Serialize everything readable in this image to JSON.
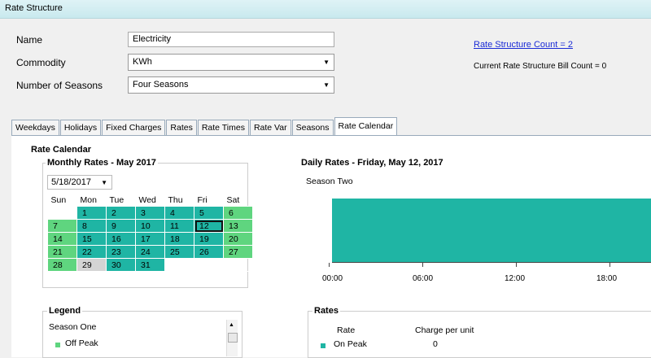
{
  "window": {
    "title": "Rate Structure"
  },
  "form": {
    "name_label": "Name",
    "name_value": "Electricity",
    "commodity_label": "Commodity",
    "commodity_value": "KWh",
    "seasons_label": "Number of Seasons",
    "seasons_value": "Four Seasons",
    "count_link": "Rate Structure Count = 2",
    "bill_count": "Current Rate Structure Bill Count = 0"
  },
  "tabs": [
    {
      "label": "Weekdays",
      "active": false
    },
    {
      "label": "Holidays",
      "active": false
    },
    {
      "label": "Fixed Charges",
      "active": false
    },
    {
      "label": "Rates",
      "active": false
    },
    {
      "label": "Rate Times",
      "active": false
    },
    {
      "label": "Rate Var",
      "active": false
    },
    {
      "label": "Seasons",
      "active": false
    },
    {
      "label": "Rate Calendar",
      "active": true
    }
  ],
  "rate_calendar": {
    "title": "Rate Calendar",
    "monthly_title": "Monthly Rates - May 2017",
    "date_value": "5/18/2017",
    "weekdays": [
      "Sun",
      "Mon",
      "Tue",
      "Wed",
      "Thu",
      "Fri",
      "Sat"
    ],
    "weeks": [
      [
        {
          "d": "",
          "c": ""
        },
        {
          "d": "1",
          "c": "teal"
        },
        {
          "d": "2",
          "c": "teal"
        },
        {
          "d": "3",
          "c": "teal"
        },
        {
          "d": "4",
          "c": "teal"
        },
        {
          "d": "5",
          "c": "teal"
        },
        {
          "d": "6",
          "c": "green"
        }
      ],
      [
        {
          "d": "7",
          "c": "green"
        },
        {
          "d": "8",
          "c": "teal"
        },
        {
          "d": "9",
          "c": "teal"
        },
        {
          "d": "10",
          "c": "teal"
        },
        {
          "d": "11",
          "c": "teal"
        },
        {
          "d": "12",
          "c": "teal today"
        },
        {
          "d": "13",
          "c": "green"
        }
      ],
      [
        {
          "d": "14",
          "c": "green"
        },
        {
          "d": "15",
          "c": "teal"
        },
        {
          "d": "16",
          "c": "teal"
        },
        {
          "d": "17",
          "c": "teal"
        },
        {
          "d": "18",
          "c": "teal"
        },
        {
          "d": "19",
          "c": "teal"
        },
        {
          "d": "20",
          "c": "green"
        }
      ],
      [
        {
          "d": "21",
          "c": "green"
        },
        {
          "d": "22",
          "c": "teal"
        },
        {
          "d": "23",
          "c": "teal"
        },
        {
          "d": "24",
          "c": "teal"
        },
        {
          "d": "25",
          "c": "teal"
        },
        {
          "d": "26",
          "c": "teal"
        },
        {
          "d": "27",
          "c": "green"
        }
      ],
      [
        {
          "d": "28",
          "c": "green"
        },
        {
          "d": "29",
          "c": "gray"
        },
        {
          "d": "30",
          "c": "teal"
        },
        {
          "d": "31",
          "c": "teal"
        },
        {
          "d": "",
          "c": ""
        },
        {
          "d": "",
          "c": ""
        },
        {
          "d": "",
          "c": ""
        }
      ]
    ],
    "daily_title": "Daily Rates - Friday, May 12, 2017",
    "season": "Season Two",
    "ticks": [
      "00:00",
      "06:00",
      "12:00",
      "18:00"
    ],
    "legend_title": "Legend",
    "legend_season": "Season One",
    "legend_items": [
      "Off Peak"
    ],
    "rates_title": "Rates",
    "rates_col_rate": "Rate",
    "rates_col_charge": "Charge per unit",
    "rates_row_name": "On Peak",
    "rates_row_charge": "0"
  },
  "colors": {
    "teal": "#1fb5a4",
    "green": "#5fd57f",
    "gray": "#d4d4d4",
    "link": "#1a2bd6"
  }
}
